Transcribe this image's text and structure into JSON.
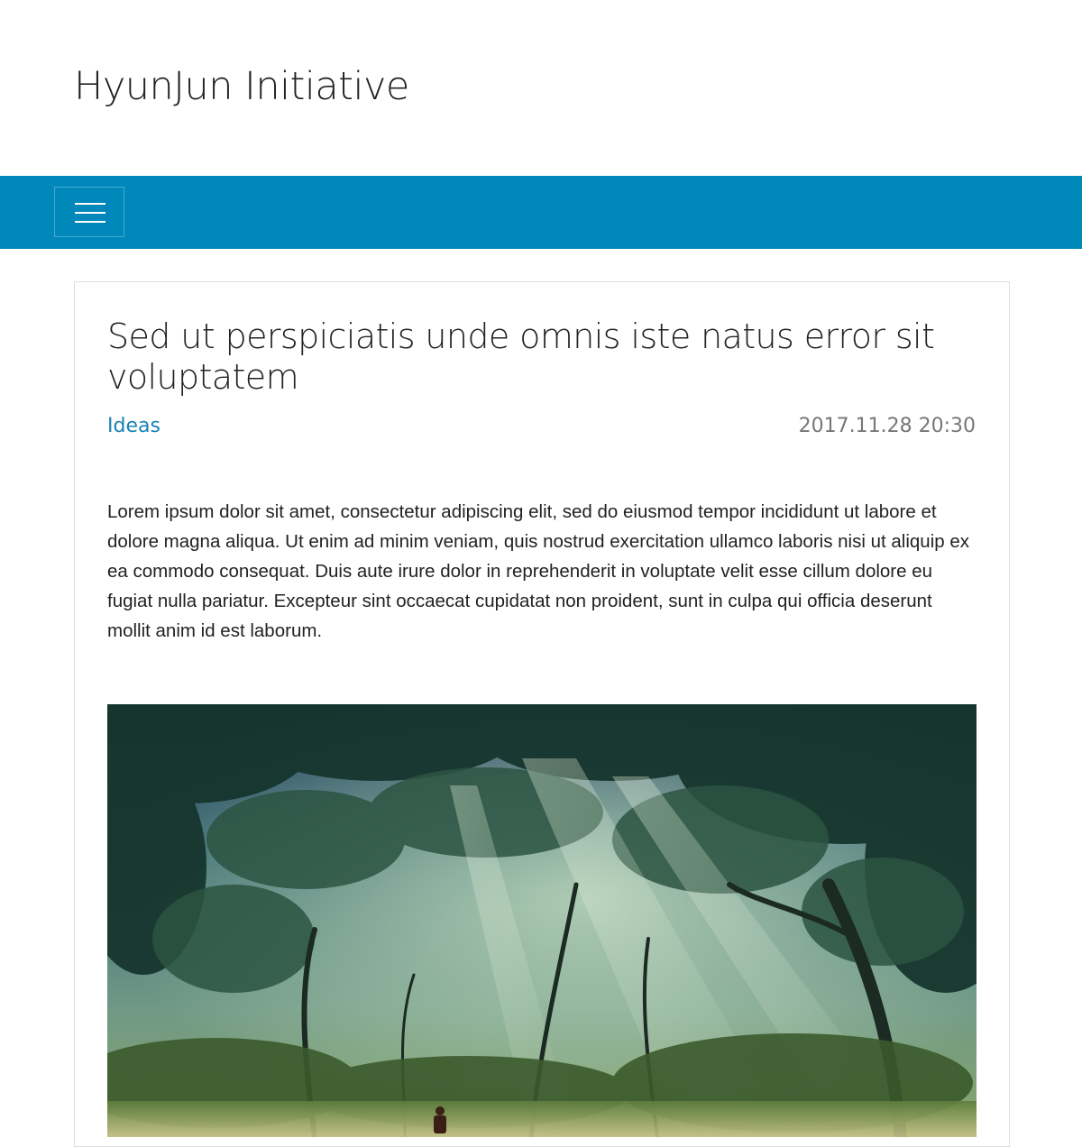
{
  "site": {
    "title": "HyunJun Initiative"
  },
  "navbar": {
    "color": "#0088bb"
  },
  "post": {
    "title": "Sed ut perspiciatis unde omnis iste natus error sit voluptatem",
    "category": "Ideas",
    "category_color": "#1a82b4",
    "date": "2017.11.28 20:30",
    "body": "Lorem ipsum dolor sit amet, consectetur adipiscing elit, sed do eiusmod tempor incididunt ut labore et dolore magna aliqua. Ut enim ad minim veniam, quis nostrud exercitation ullamco laboris nisi ut aliquip ex ea commodo consequat. Duis aute irure dolor in reprehenderit in voluptate velit esse cillum dolore eu fugiat nulla pariatur. Excepteur sint occaecat cupidatat non proident, sunt in culpa qui officia deserunt mollit anim id est laborum."
  },
  "icons": {
    "menu": "hamburger-menu-icon"
  }
}
